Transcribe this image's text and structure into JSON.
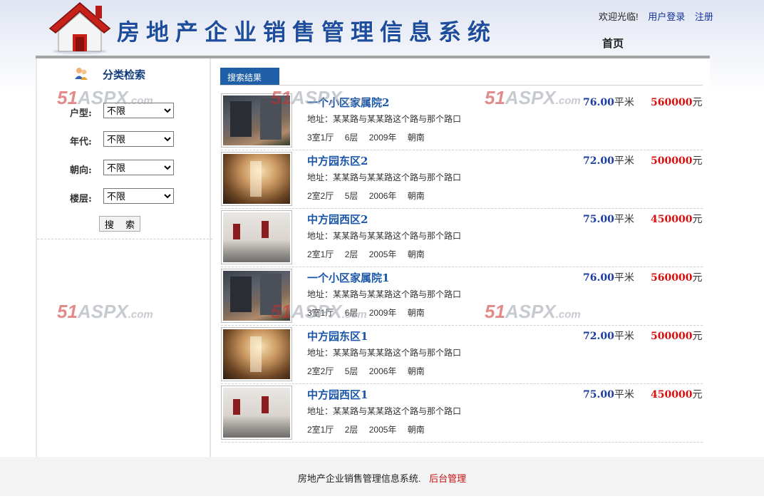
{
  "header": {
    "title": "房地产企业销售管理信息系统",
    "welcome": "欢迎光临!",
    "login": "用户登录",
    "register": "注册",
    "home": "首页"
  },
  "sidebar": {
    "title": "分类检索",
    "filters": [
      {
        "label": "户型:",
        "value": "不限"
      },
      {
        "label": "年代:",
        "value": "不限"
      },
      {
        "label": "朝向:",
        "value": "不限"
      },
      {
        "label": "楼层:",
        "value": "不限"
      }
    ],
    "search_button": "搜 索"
  },
  "results": {
    "tab": "搜索结果",
    "items": [
      {
        "name": "一个小区家属院2",
        "address": "地址：某某路与某某路这个路与那个路口",
        "layout": "3室1厅",
        "floor": "6层",
        "year": "2009年",
        "orientation": "朝南",
        "area": "76.00",
        "area_unit": "平米",
        "price": "560000",
        "price_unit": "元",
        "thumb": "a"
      },
      {
        "name": "中方园东区2",
        "address": "地址：某某路与某某路这个路与那个路口",
        "layout": "2室2厅",
        "floor": "5层",
        "year": "2006年",
        "orientation": "朝南",
        "area": "72.00",
        "area_unit": "平米",
        "price": "500000",
        "price_unit": "元",
        "thumb": "b"
      },
      {
        "name": "中方园西区2",
        "address": "地址：某某路与某某路这个路与那个路口",
        "layout": "2室1厅",
        "floor": "2层",
        "year": "2005年",
        "orientation": "朝南",
        "area": "75.00",
        "area_unit": "平米",
        "price": "450000",
        "price_unit": "元",
        "thumb": "c"
      },
      {
        "name": "一个小区家属院1",
        "address": "地址：某某路与某某路这个路与那个路口",
        "layout": "3室1厅",
        "floor": "6层",
        "year": "2009年",
        "orientation": "朝南",
        "area": "76.00",
        "area_unit": "平米",
        "price": "560000",
        "price_unit": "元",
        "thumb": "a"
      },
      {
        "name": "中方园东区1",
        "address": "地址：某某路与某某路这个路与那个路口",
        "layout": "2室2厅",
        "floor": "5层",
        "year": "2006年",
        "orientation": "朝南",
        "area": "72.00",
        "area_unit": "平米",
        "price": "500000",
        "price_unit": "元",
        "thumb": "b"
      },
      {
        "name": "中方园西区1",
        "address": "地址：某某路与某某路这个路与那个路口",
        "layout": "2室1厅",
        "floor": "2层",
        "year": "2005年",
        "orientation": "朝南",
        "area": "75.00",
        "area_unit": "平米",
        "price": "450000",
        "price_unit": "元",
        "thumb": "c"
      }
    ]
  },
  "footer": {
    "text": "房地产企业销售管理信息系统.",
    "admin_link": "后台管理"
  },
  "watermark": {
    "brand": "51",
    "brand2": "ASPX",
    "suffix": ".com"
  }
}
